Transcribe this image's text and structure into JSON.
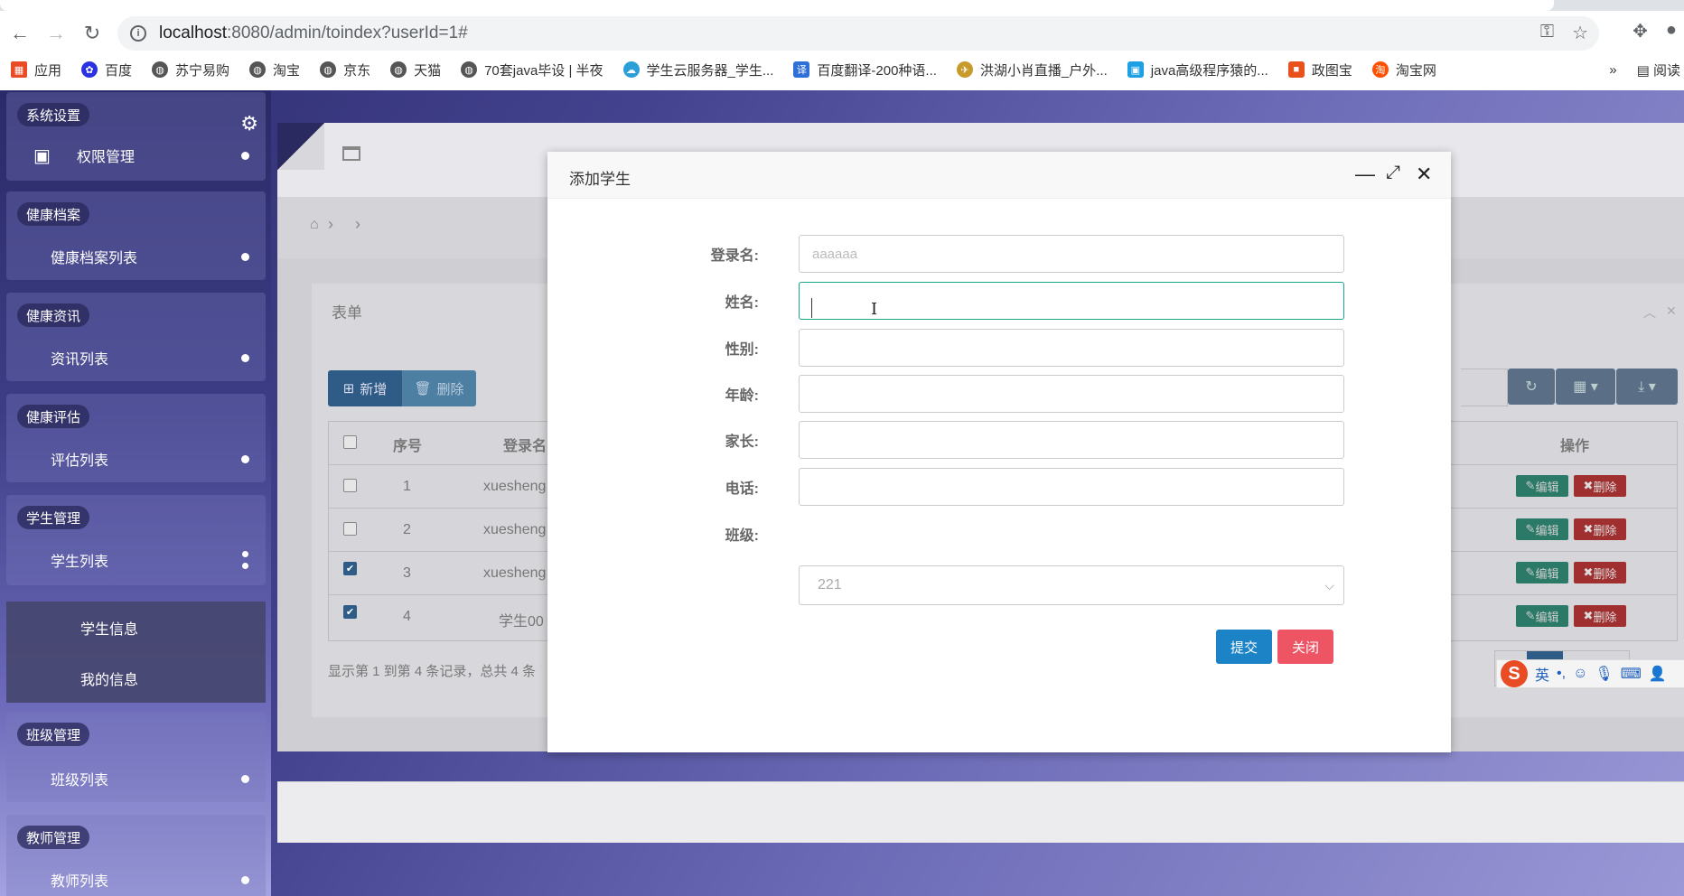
{
  "browser": {
    "url_host": "localhost",
    "url_path": ":8080/admin/toindex?userId=1#",
    "bookmarks": [
      "应用",
      "百度",
      "苏宁易购",
      "淘宝",
      "京东",
      "天猫",
      "70套java毕设 | 半夜",
      "学生云服务器_学生...",
      "百度翻译-200种语...",
      "洪湖小肖直播_户外...",
      "java高级程序猿的...",
      "政图宝",
      "淘宝网"
    ],
    "bookmark_more": "»",
    "reading_list": "阅读"
  },
  "sidebar": {
    "groups": [
      {
        "title": "系统设置",
        "items": [
          "权限管理"
        ]
      },
      {
        "title": "健康档案",
        "items": [
          "健康档案列表"
        ]
      },
      {
        "title": "健康资讯",
        "items": [
          "资讯列表"
        ]
      },
      {
        "title": "健康评估",
        "items": [
          "评估列表"
        ]
      },
      {
        "title": "学生管理",
        "items": [
          "学生列表"
        ],
        "sub": [
          "学生信息",
          "我的信息"
        ]
      },
      {
        "title": "班级管理",
        "items": [
          "班级列表"
        ]
      },
      {
        "title": "教师管理",
        "items": [
          "教师列表"
        ]
      }
    ]
  },
  "main": {
    "panel_title": "表单",
    "add_label": "新增",
    "delete_label": "删除",
    "columns": [
      "序号",
      "登录名",
      "操作"
    ],
    "rows": [
      {
        "no": "1",
        "login": "xuesheng",
        "checked": false
      },
      {
        "no": "2",
        "login": "xuesheng",
        "checked": false
      },
      {
        "no": "3",
        "login": "xuesheng",
        "checked": true
      },
      {
        "no": "4",
        "login": "学生00",
        "checked": true
      }
    ],
    "edit_label": "编辑",
    "remove_label": "删除",
    "paging_text": "显示第 1 到第 4 条记录，总共 4 条"
  },
  "ime": {
    "mode": "英"
  },
  "modal": {
    "title": "添加学生",
    "fields": [
      {
        "label": "登录名:",
        "value": "",
        "placeholder": "aaaaaa"
      },
      {
        "label": "姓名:",
        "value": "",
        "placeholder": ""
      },
      {
        "label": "性别:",
        "value": "",
        "placeholder": ""
      },
      {
        "label": "年龄:",
        "value": "",
        "placeholder": ""
      },
      {
        "label": "家长:",
        "value": "",
        "placeholder": ""
      },
      {
        "label": "电话:",
        "value": "",
        "placeholder": ""
      }
    ],
    "class_label": "班级:",
    "class_value": "221",
    "submit_label": "提交",
    "close_label": "关闭"
  }
}
